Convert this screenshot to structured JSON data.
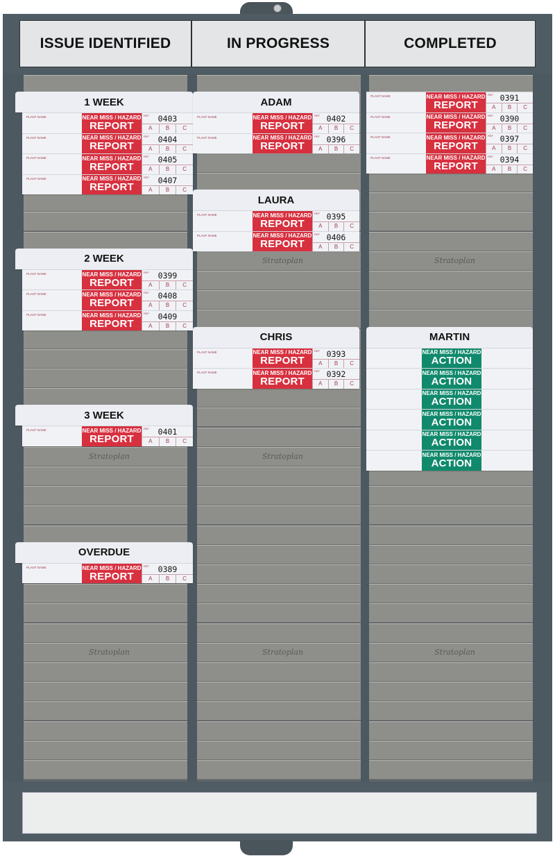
{
  "board": {
    "brand": "Stratoplan",
    "columns": [
      {
        "title": "ISSUE IDENTIFIED"
      },
      {
        "title": "IN PROGRESS"
      },
      {
        "title": "COMPLETED"
      }
    ],
    "footer_label": ""
  },
  "card_text": {
    "plant_name": "PLANT NAME",
    "ref": "REF",
    "near_miss": "NEAR MISS / HAZARD",
    "report": "REPORT",
    "action": "ACTION",
    "a": "A",
    "b": "B",
    "c": "C"
  },
  "groups": [
    {
      "column": 0,
      "title": "1 WEEK",
      "type": "report",
      "refs": [
        "0403",
        "0404",
        "0405",
        "0407"
      ]
    },
    {
      "column": 0,
      "title": "2 WEEK",
      "type": "report",
      "refs": [
        "0399",
        "0408",
        "0409"
      ]
    },
    {
      "column": 0,
      "title": "3 WEEK",
      "type": "report",
      "refs": [
        "0401"
      ]
    },
    {
      "column": 0,
      "title": "OVERDUE",
      "type": "report",
      "refs": [
        "0389"
      ]
    },
    {
      "column": 1,
      "title": "ADAM",
      "type": "report",
      "refs": [
        "0402",
        "0396"
      ]
    },
    {
      "column": 1,
      "title": "LAURA",
      "type": "report",
      "refs": [
        "0395",
        "0406"
      ]
    },
    {
      "column": 1,
      "title": "CHRIS",
      "type": "report",
      "refs": [
        "0393",
        "0392"
      ]
    },
    {
      "column": 2,
      "title": "",
      "type": "report",
      "refs": [
        "0391",
        "0390",
        "0397",
        "0394"
      ]
    },
    {
      "column": 2,
      "title": "MARTIN",
      "type": "action",
      "count": 6
    }
  ]
}
